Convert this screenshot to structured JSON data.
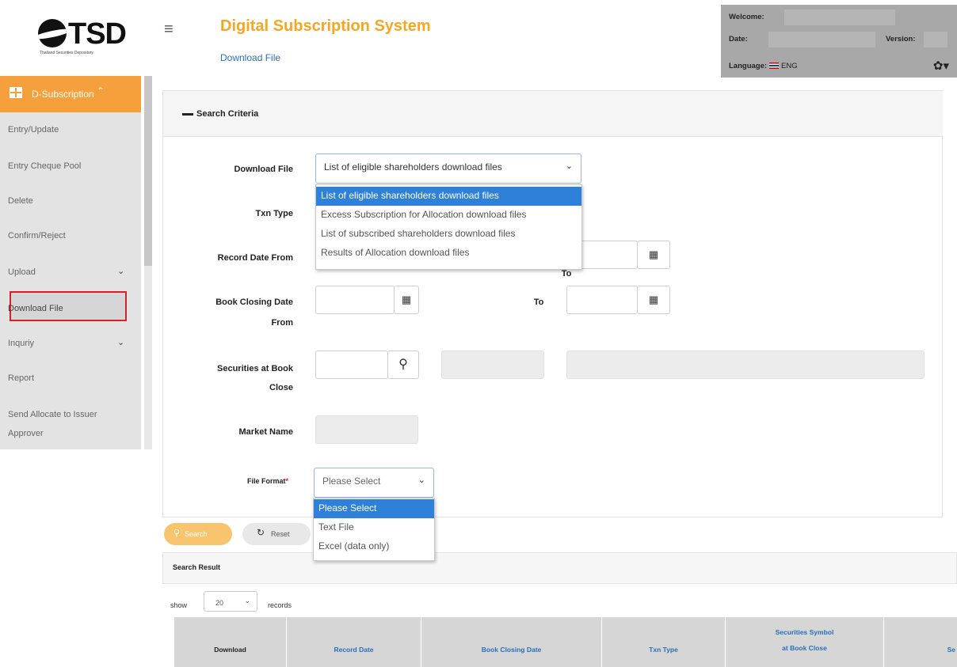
{
  "logo": {
    "text": "TSD",
    "subtext": "Thailand Securities Depository"
  },
  "header": {
    "title": "Digital Subscription System",
    "breadcrumb": "Download File"
  },
  "user_info": {
    "welcome_label": "Welcome:",
    "date_label": "Date:",
    "version_label": "Version:",
    "language_label": "Language:",
    "language_value": "ENG"
  },
  "sidebar": {
    "section": "D-Subscription",
    "items": [
      {
        "label": "Entry/Update"
      },
      {
        "label": "Entry Cheque Pool"
      },
      {
        "label": "Delete"
      },
      {
        "label": "Confirm/Reject"
      },
      {
        "label": "Upload"
      },
      {
        "label": "Download File"
      },
      {
        "label": "Inquriy"
      },
      {
        "label": "Report"
      },
      {
        "label": "Send Allocate to Issuer"
      },
      {
        "label": "Approver"
      }
    ]
  },
  "search": {
    "title": "Search Criteria",
    "download_file_label": "Download File",
    "download_file_value": "List of eligible shareholders download files",
    "download_file_options": [
      "List of eligible shareholders download files",
      "Excess Subscription for Allocation download files",
      "List of subscribed shareholders download files",
      "Results of Allocation download files"
    ],
    "txn_type_label": "Txn Type",
    "record_date_label": "Record Date From",
    "to_label": "To",
    "book_closing_label_1": "Book Closing Date",
    "book_closing_label_2": "From",
    "securities_label_1": "Securities at Book",
    "securities_label_2": "Close",
    "market_name_label": "Market Name",
    "file_format_label": "File Format",
    "required_mark": "*",
    "file_format_value": "Please Select",
    "file_format_options": [
      "Please Select",
      "Text File",
      "Excel (data only)"
    ],
    "search_button": "Search",
    "reset_button": "Reset"
  },
  "results": {
    "title": "Search Result",
    "show_label": "show",
    "page_size": "20",
    "records_label": "records",
    "columns": [
      "Download",
      "Record Date",
      "Book Closing Date",
      "Txn Type",
      "Securities Symbol",
      "at Book Close",
      "Se"
    ]
  }
}
